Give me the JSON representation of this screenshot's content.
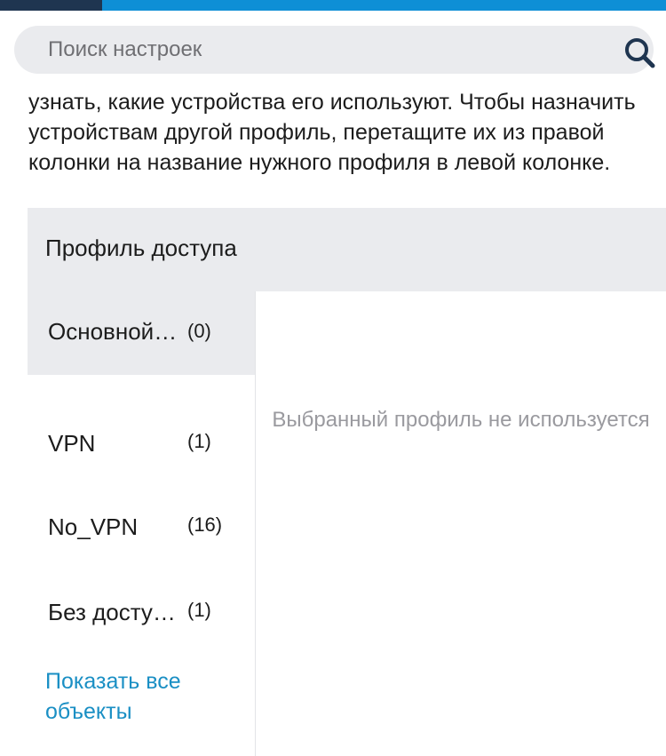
{
  "search": {
    "placeholder": "Поиск настроек"
  },
  "intro_text": "узнать, какие устройства его используют. Чтобы назначить устройствам другой профиль, перетащите их из правой колонки на название нужного профиля в левой колонке.",
  "table": {
    "header": "Профиль доступа",
    "profiles": [
      {
        "name": "Основной …",
        "count": "(0)"
      },
      {
        "name": "VPN",
        "count": "(1)"
      },
      {
        "name": "No_VPN",
        "count": "(16)"
      },
      {
        "name": "Без досту…",
        "count": "(1)"
      }
    ],
    "show_all": "Показать все объекты",
    "empty_message": "Выбранный профиль не используется"
  },
  "colors": {
    "accent": "#0e8fd6",
    "link": "#1a8fc4",
    "icon": "#1f3550"
  },
  "icons": {
    "search": "search-icon"
  }
}
